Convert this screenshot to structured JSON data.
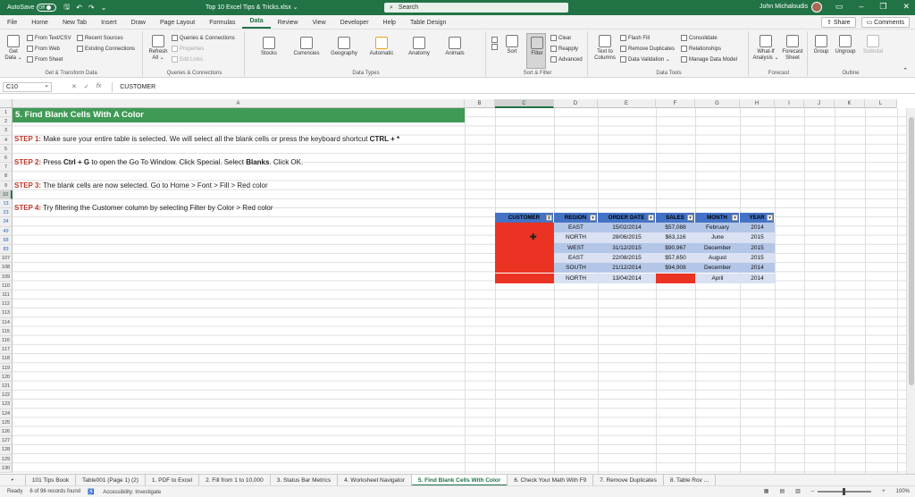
{
  "titlebar": {
    "autosave": "AutoSave",
    "toggle": "Off",
    "doc": "Top 10 Excel Tips & Tricks.xlsx",
    "search": "Search",
    "user": "John Michaloudis"
  },
  "menu": {
    "tabs": [
      "File",
      "Home",
      "New Tab",
      "Insert",
      "Draw",
      "Page Layout",
      "Formulas",
      "Data",
      "Review",
      "View",
      "Developer",
      "Help",
      "Table Design"
    ],
    "active": "Data",
    "share": "Share",
    "comments": "Comments"
  },
  "ribbon": {
    "get_data": "Get Data ⌄",
    "from_text": "From Text/CSV",
    "from_web": "From Web",
    "from_sheet": "From Sheet",
    "recent": "Recent Sources",
    "existing": "Existing Connections",
    "g1": "Get & Transform Data",
    "refresh": "Refresh All ⌄",
    "queries": "Queries & Connections",
    "properties": "Properties",
    "edit_links": "Edit Links",
    "g2": "Queries & Connections",
    "types": [
      "Stocks",
      "Currencies",
      "Geography",
      "Automatic",
      "Anatomy",
      "Animals"
    ],
    "g3": "Data Types",
    "sort": "Sort",
    "filter": "Filter",
    "clear": "Clear",
    "reapply": "Reapply",
    "advanced": "Advanced",
    "g4": "Sort & Filter",
    "text_cols": "Text to Columns",
    "flash": "Flash Fill",
    "remove_dup": "Remove Duplicates",
    "validation": "Data Validation ⌄",
    "consolidate": "Consolidate",
    "relationships": "Relationships",
    "model": "Manage Data Model",
    "g5": "Data Tools",
    "whatif": "What-If Analysis ⌄",
    "forecast": "Forecast Sheet",
    "g6": "Forecast",
    "group": "Group",
    "ungroup": "Ungroup",
    "subtotal": "Subtotal",
    "g7": "Outline"
  },
  "formula": {
    "namebox": "C10",
    "fx": "fx",
    "value": "CUSTOMER"
  },
  "columns": [
    "A",
    "B",
    "C",
    "D",
    "E",
    "F",
    "G",
    "H",
    "I",
    "J",
    "K",
    "L"
  ],
  "rows": [
    "1",
    "2",
    "3",
    "4",
    "5",
    "6",
    "7",
    "8",
    "9",
    "10",
    "13",
    "23",
    "34",
    "49",
    "68",
    "83",
    "107",
    "108",
    "109",
    "110",
    "111",
    "112",
    "113",
    "114",
    "115",
    "116",
    "117",
    "118",
    "119",
    "120",
    "121",
    "122",
    "123",
    "124",
    "125",
    "126",
    "127",
    "128",
    "129",
    "130"
  ],
  "sheet": {
    "banner": "5. Find Blank Cells With A Color",
    "steps": [
      {
        "label": "STEP 1:",
        "pre": " Make sure your entire table is selected. We will select all the blank cells or press the keyboard shortcut ",
        "bold": "CTRL + *",
        "post": ""
      },
      {
        "label": "STEP 2:",
        "pre": " Press ",
        "bold": "Ctrl + G",
        "post": " to open the Go To Window. Click Special. Select ",
        "bold2": "Blanks",
        "post2": ". Click OK."
      },
      {
        "label": "STEP 3:",
        "pre": " The blank cells are now selected. Go to Home > Font > Fill > Red color",
        "bold": "",
        "post": ""
      },
      {
        "label": "STEP 4:",
        "pre": " Try filtering the Customer column by selecting Filter by Color > Red color",
        "bold": "",
        "post": ""
      }
    ]
  },
  "table": {
    "headers": [
      "CUSTOMER",
      "REGION",
      "ORDER DATE",
      "SALES",
      "MONTH",
      "YEAR"
    ],
    "rows": [
      [
        "",
        "EAST",
        "15/02/2014",
        "$57,088",
        "February",
        "2014"
      ],
      [
        "",
        "NORTH",
        "28/06/2015",
        "$63,116",
        "June",
        "2015"
      ],
      [
        "",
        "WEST",
        "31/12/2015",
        "$90,967",
        "December",
        "2015"
      ],
      [
        "",
        "EAST",
        "22/08/2015",
        "$57,650",
        "August",
        "2015"
      ],
      [
        "",
        "SOUTH",
        "21/12/2014",
        "$94,908",
        "December",
        "2014"
      ],
      [
        "",
        "NORTH",
        "13/04/2014",
        "",
        "April",
        "2014"
      ]
    ],
    "red": "#ea3323"
  },
  "sheettabs": [
    "101 Tips Book",
    "Table001 (Page 1) (2)",
    "1. PDF to Excel",
    "2. Fill from 1 to 10,000",
    "3. Status Bar Metrics",
    "4. Worksheet Navigator",
    "5. Find Blank Cells With Color",
    "6. Check Your Math With F9",
    "7. Remove Duplicates",
    "8. Table Rov ..."
  ],
  "active_sheet": "5. Find Blank Cells With Color",
  "status": {
    "ready": "Ready",
    "records": "6 of 96 records found",
    "access": "Accessibility: Investigate",
    "zoom": "100%"
  }
}
